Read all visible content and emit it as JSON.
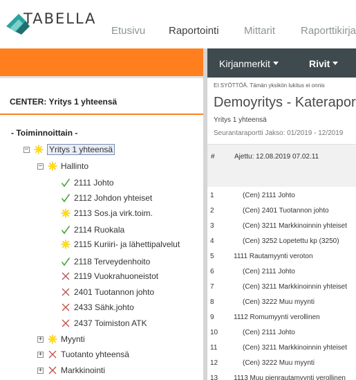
{
  "app": {
    "logo_text": "TABELLA",
    "brand_colors": {
      "teal": "#2aa4a0",
      "dark_teal": "#1f6f6f",
      "orange": "#ff7f1f",
      "toolbar": "#3f4a4f"
    }
  },
  "nav": {
    "items": [
      {
        "label": "Etusivu",
        "active": false
      },
      {
        "label": "Raportointi",
        "active": true
      },
      {
        "label": "Mittarit",
        "active": false
      },
      {
        "label": "Raporttikirja",
        "active": false
      }
    ]
  },
  "toolbar": {
    "bookmarks_label": "Kirjanmerkit",
    "rows_label": "Rivit"
  },
  "left": {
    "center_title": "CENTER: Yritys 1 yhteensä",
    "root_label": "- Toiminnoittain -",
    "tree": [
      {
        "label": "Yritys 1 yhteensä",
        "expander": "−",
        "icon": "sun-icon",
        "selected": true
      },
      {
        "label": "Hallinto",
        "expander": "−",
        "icon": "sun-icon"
      },
      {
        "label": "2111 Johto",
        "icon": "check-icon"
      },
      {
        "label": "2112 Johdon yhteiset",
        "icon": "check-icon"
      },
      {
        "label": "2113 Sos.ja virk.toim.",
        "icon": "sun-icon"
      },
      {
        "label": "2114 Ruokala",
        "icon": "check-icon"
      },
      {
        "label": "2115 Kuriiri- ja lähettipalvelut",
        "icon": "sun-icon"
      },
      {
        "label": "2118 Terveydenhoito",
        "icon": "check-icon"
      },
      {
        "label": "2119 Vuokrahuoneistot",
        "icon": "cross-icon"
      },
      {
        "label": "2401 Tuotannon johto",
        "icon": "cross-icon"
      },
      {
        "label": "2433 Sähk.johto",
        "icon": "cross-icon"
      },
      {
        "label": "2437 Toimiston ATK",
        "icon": "cross-icon"
      },
      {
        "label": "Myynti",
        "expander": "+",
        "icon": "sun-icon"
      },
      {
        "label": "Tuotanto yhteensä",
        "expander": "+",
        "icon": "cross-icon"
      },
      {
        "label": "Markkinointi",
        "expander": "+",
        "icon": "cross-icon"
      }
    ]
  },
  "report": {
    "notice": "EI SYÖTTÖÄ. Tämän yksikön lukitus ei onnis",
    "title": "Demoyritys - Kateraport",
    "subtitle": "Yritys 1 yhteensä",
    "period": "Seurantaraportti Jakso: 01/2019 - 12/2019",
    "hash_header": "#",
    "run_info": "Ajettu: 12.08.2019 07.02.11",
    "rows": [
      {
        "num": "1",
        "text": "(Cen) 2111 Johto",
        "indent": true
      },
      {
        "num": "2",
        "text": "(Cen) 2401 Tuotannon johto",
        "indent": true
      },
      {
        "num": "3",
        "text": "(Cen) 3211 Markkinoinnin yhteiset",
        "indent": true
      },
      {
        "num": "4",
        "text": "(Cen) 3252 Lopetettu kp (3250)",
        "indent": true
      },
      {
        "num": "5",
        "text": "1111 Rautamyynti veroton",
        "indent": false
      },
      {
        "num": "6",
        "text": "(Cen) 2111 Johto",
        "indent": true
      },
      {
        "num": "7",
        "text": "(Cen) 3211 Markkinoinnin yhteiset",
        "indent": true
      },
      {
        "num": "8",
        "text": "(Cen) 3222 Muu myynti",
        "indent": true
      },
      {
        "num": "9",
        "text": "1112 Romumyynti verollinen",
        "indent": false
      },
      {
        "num": "10",
        "text": "(Cen) 2111 Johto",
        "indent": true
      },
      {
        "num": "11",
        "text": "(Cen) 3211 Markkinoinnin yhteiset",
        "indent": true
      },
      {
        "num": "12",
        "text": "(Cen) 3222 Muu myynti",
        "indent": true
      },
      {
        "num": "13",
        "text": "1113 Muu pienrautamyynti verollinen",
        "indent": false
      }
    ]
  }
}
